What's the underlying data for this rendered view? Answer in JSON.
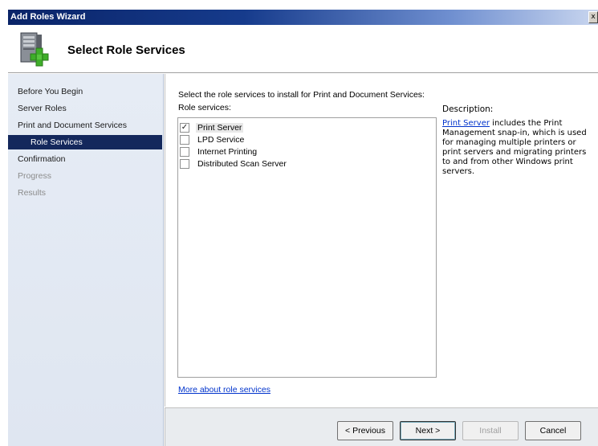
{
  "window": {
    "title": "Add Roles Wizard",
    "close_glyph": "x"
  },
  "header": {
    "title": "Select Role Services",
    "icon": "server-add-icon"
  },
  "sidebar": {
    "items": [
      {
        "label": "Before You Begin",
        "state": "normal"
      },
      {
        "label": "Server Roles",
        "state": "normal"
      },
      {
        "label": "Print and Document Services",
        "state": "normal"
      },
      {
        "label": "Role Services",
        "state": "selected"
      },
      {
        "label": "Confirmation",
        "state": "normal"
      },
      {
        "label": "Progress",
        "state": "disabled"
      },
      {
        "label": "Results",
        "state": "disabled"
      }
    ]
  },
  "content": {
    "instruction": "Select the role services to install for Print and Document Services:",
    "role_services_label": "Role services:",
    "services": [
      {
        "label": "Print Server",
        "checked": true
      },
      {
        "label": "LPD Service",
        "checked": false
      },
      {
        "label": "Internet Printing",
        "checked": false
      },
      {
        "label": "Distributed Scan Server",
        "checked": false
      }
    ],
    "check_glyph": "✓",
    "more_link": "More about role services"
  },
  "description": {
    "title": "Description:",
    "link_text": "Print Server",
    "body": " includes the Print Management snap-in, which is used for managing multiple printers or print servers and migrating printers to and from other Windows print servers."
  },
  "footer": {
    "previous": "< Previous",
    "next": "Next >",
    "install": "Install",
    "cancel": "Cancel"
  },
  "colors": {
    "selected_bg": "#14285c",
    "link": "#0033cc"
  }
}
